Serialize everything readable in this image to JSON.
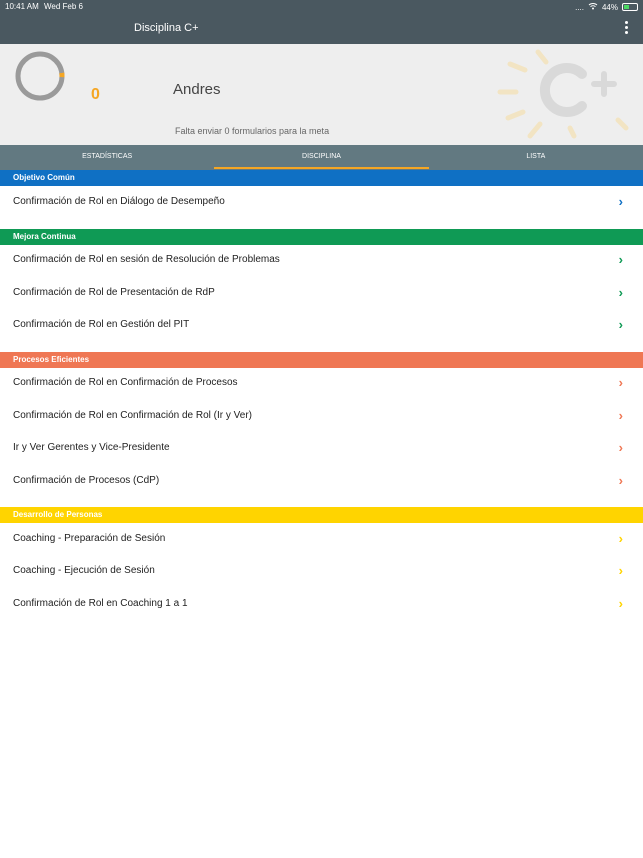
{
  "status_bar": {
    "time": "10:41 AM",
    "date": "Wed Feb 6",
    "signal": "....",
    "battery": "44%"
  },
  "header": {
    "title": "Disciplina C+"
  },
  "profile": {
    "count": "0",
    "name": "Andres",
    "goal_text": "Falta enviar 0 formularios para la meta",
    "ring_progress": 0.03
  },
  "tabs": [
    {
      "label": "ESTADÍSTICAS",
      "active": false
    },
    {
      "label": "DISCIPLINA",
      "active": true
    },
    {
      "label": "LISTA",
      "active": false
    }
  ],
  "sections": [
    {
      "title": "Objetivo Común",
      "color": "#0f70c4",
      "items": [
        "Confirmación de Rol en Diálogo de Desempeño"
      ]
    },
    {
      "title": "Mejora Continua",
      "color": "#0f9a55",
      "items": [
        "Confirmación de Rol en sesión de Resolución de Problemas",
        "Confirmación de Rol de Presentación de RdP",
        "Confirmación de Rol en Gestión del PIT"
      ]
    },
    {
      "title": "Procesos Eficientes",
      "color": "#ef7754",
      "items": [
        "Confirmación de Rol en Confirmación de Procesos",
        "Confirmación de Rol en Confirmación de Rol (Ir y Ver)",
        "Ir y Ver Gerentes y Vice-Presidente",
        "Confirmación de Procesos (CdP)"
      ]
    },
    {
      "title": "Desarrollo de Personas",
      "color": "#ffd400",
      "items": [
        "Coaching -  Preparación de Sesión",
        "Coaching -  Ejecución de Sesión",
        "Confirmación de Rol en Coaching 1 a 1"
      ]
    }
  ],
  "icons": {
    "chevron": "chevron-right-icon",
    "menu": "more-vertical-icon",
    "wifi": "wifi-icon",
    "battery": "battery-icon"
  }
}
